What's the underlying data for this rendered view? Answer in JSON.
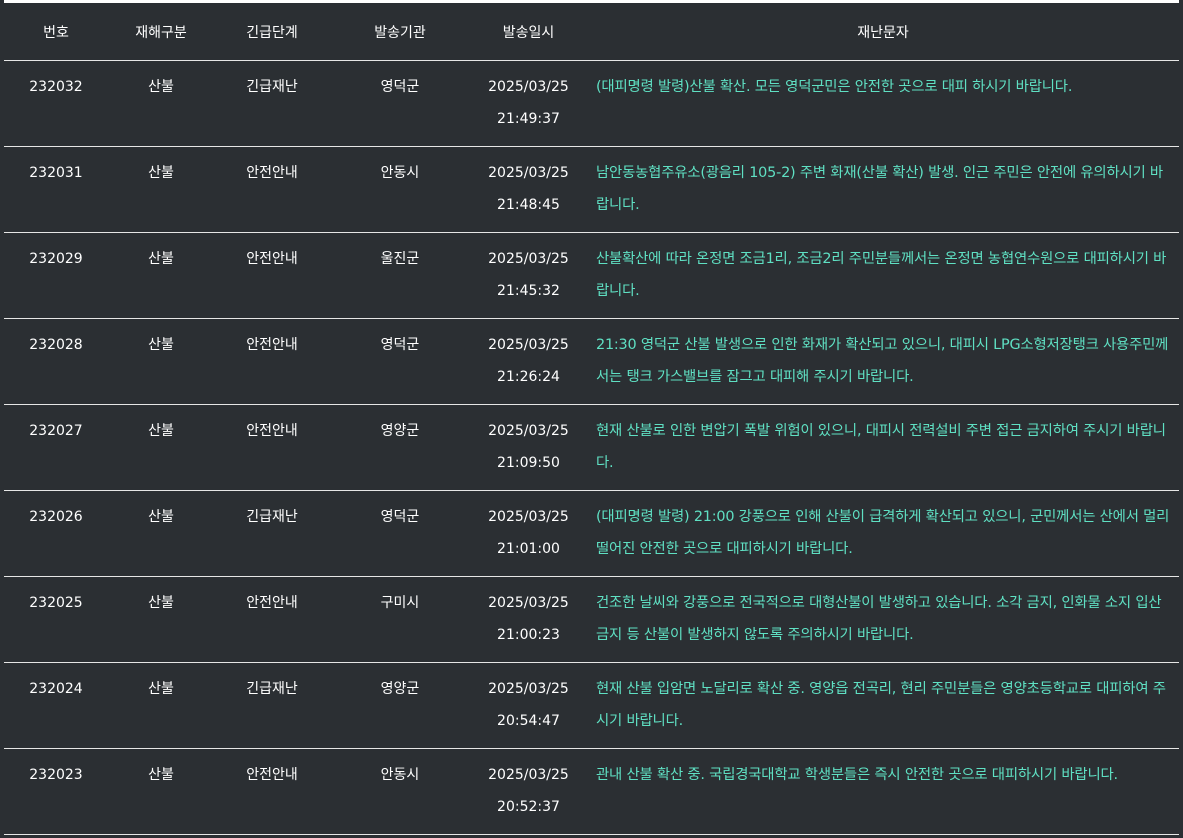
{
  "table": {
    "headers": {
      "no": "번호",
      "type": "재해구분",
      "level": "긴급단계",
      "agency": "발송기관",
      "datetime": "발송일시",
      "message": "재난문자"
    },
    "rows": [
      {
        "no": "232032",
        "type": "산불",
        "level": "긴급재난",
        "agency": "영덕군",
        "date": "2025/03/25",
        "time": "21:49:37",
        "message": "(대피명령 발령)산불 확산. 모든 영덕군민은 안전한 곳으로 대피 하시기 바랍니다."
      },
      {
        "no": "232031",
        "type": "산불",
        "level": "안전안내",
        "agency": "안동시",
        "date": "2025/03/25",
        "time": "21:48:45",
        "message": "남안동농협주유소(광음리 105-2) 주변 화재(산불 확산) 발생. 인근 주민은 안전에 유의하시기 바랍니다."
      },
      {
        "no": "232029",
        "type": "산불",
        "level": "안전안내",
        "agency": "울진군",
        "date": "2025/03/25",
        "time": "21:45:32",
        "message": "산불확산에 따라 온정면 조금1리, 조금2리 주민분들께서는 온정면 농협연수원으로 대피하시기 바랍니다."
      },
      {
        "no": "232028",
        "type": "산불",
        "level": "안전안내",
        "agency": "영덕군",
        "date": "2025/03/25",
        "time": "21:26:24",
        "message": "21:30 영덕군 산불 발생으로 인한 화재가 확산되고 있으니, 대피시 LPG소형저장탱크 사용주민께서는 탱크 가스밸브를 잠그고 대피해 주시기 바랍니다."
      },
      {
        "no": "232027",
        "type": "산불",
        "level": "안전안내",
        "agency": "영양군",
        "date": "2025/03/25",
        "time": "21:09:50",
        "message": "현재 산불로 인한 변압기 폭발 위험이 있으니, 대피시 전력설비 주변 접근 금지하여 주시기 바랍니다."
      },
      {
        "no": "232026",
        "type": "산불",
        "level": "긴급재난",
        "agency": "영덕군",
        "date": "2025/03/25",
        "time": "21:01:00",
        "message": "(대피명령 발령) 21:00 강풍으로 인해 산불이 급격하게 확산되고 있으니, 군민께서는 산에서 멀리 떨어진 안전한 곳으로 대피하시기 바랍니다."
      },
      {
        "no": "232025",
        "type": "산불",
        "level": "안전안내",
        "agency": "구미시",
        "date": "2025/03/25",
        "time": "21:00:23",
        "message": "건조한 날씨와 강풍으로 전국적으로 대형산불이 발생하고 있습니다. 소각 금지, 인화물 소지 입산금지 등 산불이 발생하지 않도록 주의하시기 바랍니다."
      },
      {
        "no": "232024",
        "type": "산불",
        "level": "긴급재난",
        "agency": "영양군",
        "date": "2025/03/25",
        "time": "20:54:47",
        "message": "현재 산불 입암면 노달리로 확산 중. 영양읍 전곡리, 현리 주민분들은 영양초등학교로 대피하여 주시기 바랍니다."
      },
      {
        "no": "232023",
        "type": "산불",
        "level": "안전안내",
        "agency": "안동시",
        "date": "2025/03/25",
        "time": "20:52:37",
        "message": "관내 산불 확산 중. 국립경국대학교 학생분들은 즉시 안전한 곳으로 대피하시기 바랍니다."
      }
    ]
  },
  "colors": {
    "background": "#2b2f33",
    "text": "#ffffff",
    "message_text": "#5fe0c3",
    "rule": "#e6e6e6"
  }
}
